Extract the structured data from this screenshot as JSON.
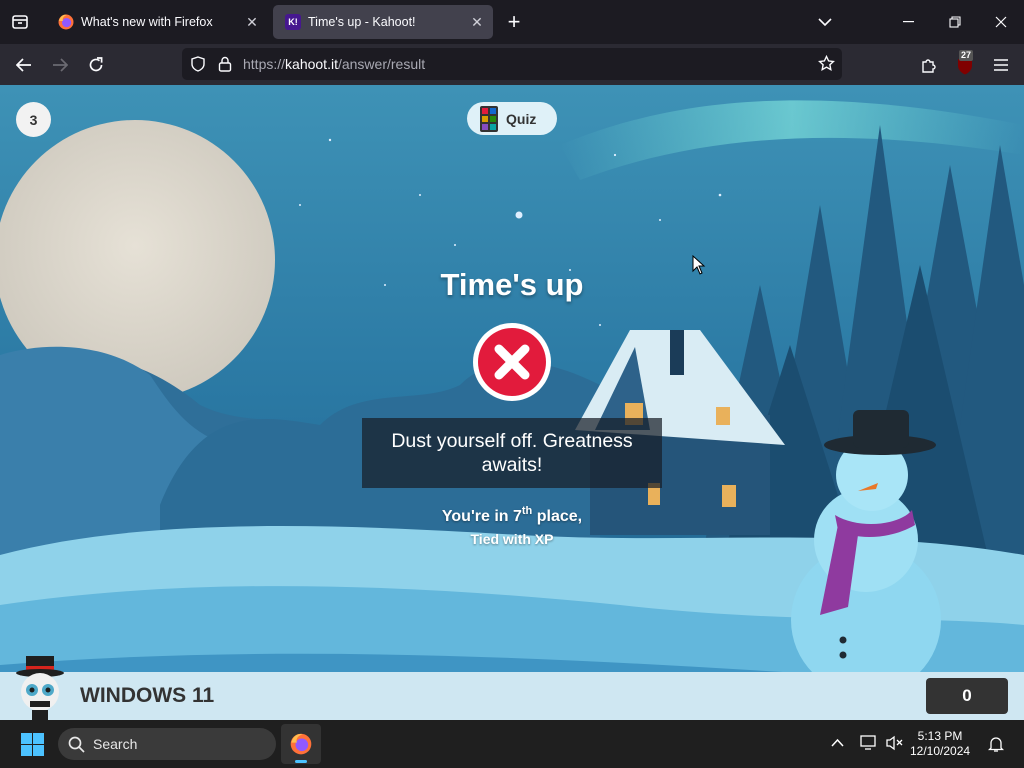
{
  "browser": {
    "tabs": [
      {
        "title": "What's new with Firefox",
        "active": false,
        "icon": "firefox-icon"
      },
      {
        "title": "Time's up - Kahoot!",
        "active": true,
        "icon": "kahoot-icon",
        "icon_text": "K!"
      }
    ],
    "url": {
      "scheme": "https://",
      "host": "kahoot.it",
      "path": "/answer/result"
    },
    "extensions_badge": "27"
  },
  "game": {
    "question_number": "3",
    "mode_label": "Quiz",
    "title": "Time's up",
    "message": "Dust yourself off. Greatness awaits!",
    "place_prefix": "You're in ",
    "place_number": "7",
    "place_suffix": "th",
    "place_end": " place,",
    "tie_text": "Tied with XP",
    "player_name": "WINDOWS 11",
    "score": "0"
  },
  "taskbar": {
    "search_placeholder": "Search",
    "time": "5:13 PM",
    "date": "12/10/2024"
  },
  "colors": {
    "accent_red": "#e21b3c",
    "kahoot_purple": "#46178f",
    "sky": "#2c7fa8"
  }
}
